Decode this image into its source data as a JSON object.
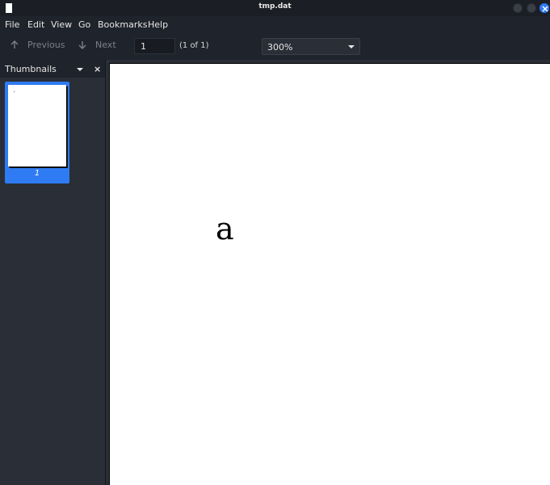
{
  "window": {
    "title": "tmp.dat"
  },
  "menubar": {
    "items": [
      "File",
      "Edit",
      "View",
      "Go",
      "Bookmarks",
      "Help"
    ]
  },
  "toolbar": {
    "previous_label": "Previous",
    "next_label": "Next",
    "page_value": "1",
    "page_count": "(1 of 1)",
    "zoom_value": "300%"
  },
  "sidebar": {
    "title": "Thumbnails",
    "close_glyph": "×",
    "thumbnails": [
      {
        "label": "1"
      }
    ]
  },
  "document": {
    "text": "a"
  },
  "icons": {
    "previous": "arrow-up-icon",
    "next": "arrow-down-icon",
    "close": "close-icon"
  },
  "colors": {
    "accent": "#2f7bf3",
    "background": "#1f232b",
    "panel": "#2a2e37"
  }
}
